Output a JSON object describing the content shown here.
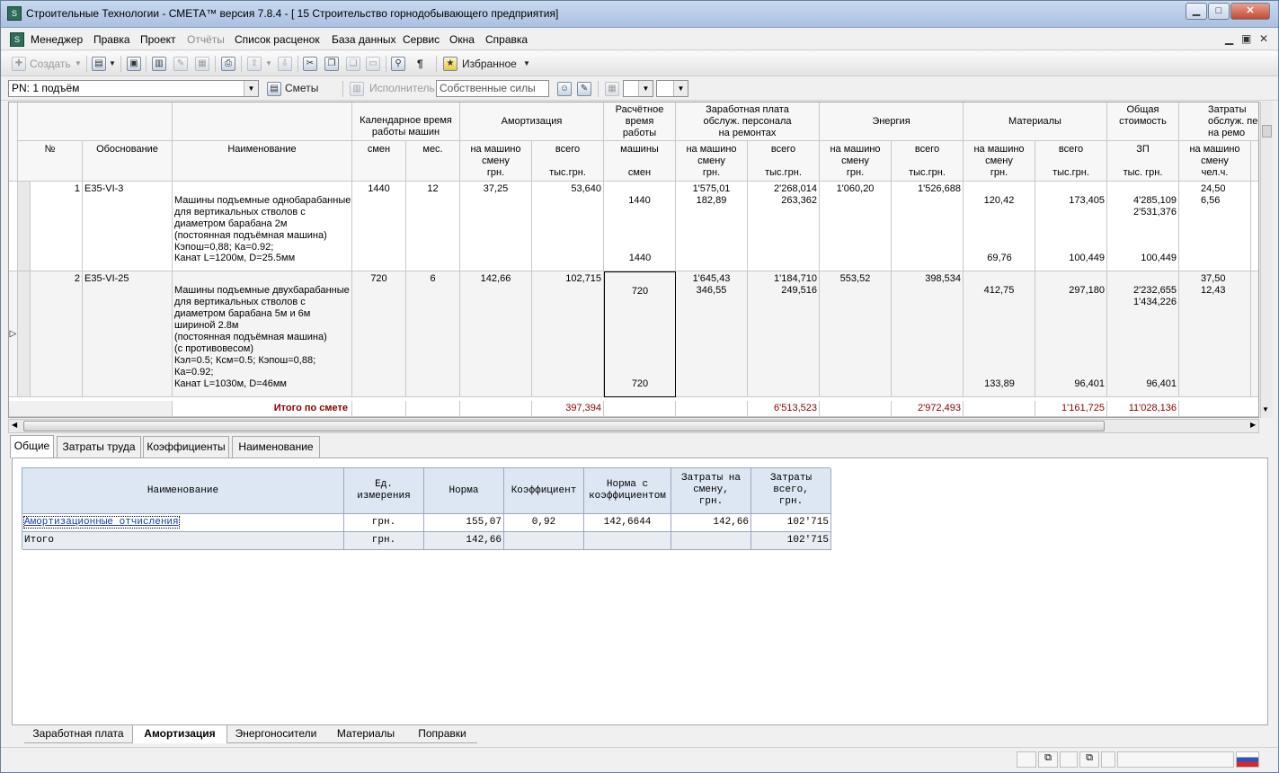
{
  "window": {
    "title": "Строительные Технологии - СМЕТА™  версия 7.8.4 - [  15  Строительство горнодобывающего предприятия]"
  },
  "menu": [
    "Менеджер",
    "Правка",
    "Проект",
    "Отчёты",
    "Список расценок",
    "База данных",
    "Сервис",
    "Окна",
    "Справка"
  ],
  "toolbar": {
    "create_label": "Создать",
    "favorites_label": "Избранное"
  },
  "toolbar2": {
    "section_value": "PN: 1 подъём",
    "smety_label": "Сметы",
    "executor_label": "Исполнитель",
    "executor_value": "Собственные силы"
  },
  "grid": {
    "group_headers": {
      "calendar_time": "Календарное время\nработы машин",
      "amortization": "Амортизация",
      "calc_time": "Расчётное\nвремя\nработы",
      "salary": "Заработная плата\nобслуж. персонала\nна ремонтах",
      "energy": "Энергия",
      "materials": "Материалы",
      "total_cost": "Общая\nстоимость",
      "labor": "Затраты\nобслуж. пе\nна ремо"
    },
    "sub_headers": {
      "no": "№",
      "basis": "Обоснование",
      "name": "Наименование",
      "shifts": "смен",
      "months": "мес.",
      "per_shift_grn": "на машино\nсмену\nгрн.",
      "total_ths": "всего\n\nтыс.грн.",
      "machines_shifts": "машины\n\nсмен",
      "zp": "ЗП\n\nтыс. грн.",
      "per_shift_chel": "на машино\nсмену\nчел.ч."
    },
    "rows": [
      {
        "no": "1",
        "basis": "Е35-VI-3",
        "name": "Машины подъемные однобарабанные\nдля вертикальных стволов с\nдиаметром барабана 2м\n(постоянная подъёмная машина)\n Кэпош=0,88; Ка=0.92;",
        "name2": "Канат L=1200м, D=25.5мм",
        "shifts": "1440",
        "months": "12",
        "am_shift": "37,25",
        "am_total": "53,640",
        "calc": "1440",
        "calc2": "1440",
        "sal_shift": "1'575,01\n182,89",
        "sal_total": "2'268,014\n263,362",
        "en_shift": "1'060,20",
        "en_total": "1'526,688",
        "mat_shift": "120,42",
        "mat_shift2": "69,76",
        "mat_total": "173,405",
        "mat_total2": "100,449",
        "cost": "4'285,109\n2'531,376",
        "cost2": "100,449",
        "labor": "24,50\n6,56"
      },
      {
        "no": "2",
        "basis": "Е35-VI-25",
        "name": "Машины подъемные двухбарабанные\nдля вертикальных стволов с\nдиаметром барабана 5м и 6м\nшириной 2.8м\n(постоянная подъёмная машина)\n(с противовесом)\n Кэл=0.5; Ксм=0.5; Кэпош=0,88;\nКа=0.92;",
        "name2": "Канат L=1030м, D=46мм",
        "shifts": "720",
        "months": "6",
        "am_shift": "142,66",
        "am_total": "102,715",
        "calc": "720",
        "calc2": "720",
        "sal_shift": "1'645,43\n346,55",
        "sal_total": "1'184,710\n249,516",
        "en_shift": "553,52",
        "en_total": "398,534",
        "mat_shift": "412,75",
        "mat_shift2": "133,89",
        "mat_total": "297,180",
        "mat_total2": "96,401",
        "cost": "2'232,655\n1'434,226",
        "cost2": "96,401",
        "labor": "37,50\n12,43"
      }
    ],
    "totals": {
      "label": "Итого по смете",
      "am_total": "397,394",
      "sal_total": "6'513,523",
      "en_total": "2'972,493",
      "mat_total": "1'161,725",
      "cost": "11'028,136"
    }
  },
  "detail_tabs_top": [
    "Общие",
    "Затраты труда",
    "Коэффициенты",
    "Наименование"
  ],
  "detail_table": {
    "headers": [
      "Наименование",
      "Ед.\nизмерения",
      "Норма",
      "Коэффициент",
      "Норма с\nкоэффициентом",
      "Затраты на\nсмену,\nгрн.",
      "Затраты\nвсего,\nгрн."
    ],
    "rows": [
      [
        "Амортизационные отчисления",
        "грн.",
        "155,07",
        "0,92",
        "142,6644",
        "142,66",
        "102'715"
      ],
      [
        "Итого",
        "грн.",
        "142,66",
        "",
        "",
        "",
        "102'715"
      ]
    ]
  },
  "detail_tabs_bottom": [
    "Заработная плата",
    "Амортизация",
    "Энергоносители",
    "Материалы",
    "Поправки"
  ]
}
